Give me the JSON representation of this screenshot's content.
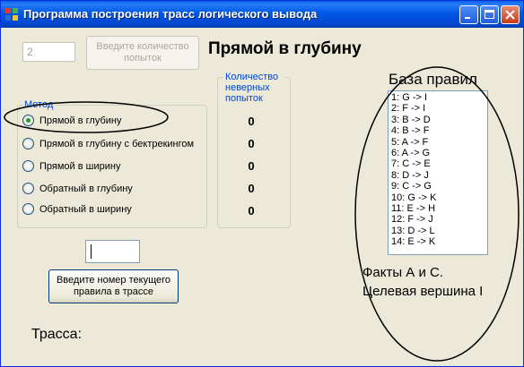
{
  "window": {
    "title": "Программа построения трасс логического вывода"
  },
  "attempts_input": {
    "value": "2"
  },
  "attempts_button": {
    "label": "Введите количество попыток"
  },
  "method_title": "Прямой в глубину",
  "method_group": {
    "caption": "Метод",
    "options": [
      {
        "label": "Прямой в глубину",
        "checked": true
      },
      {
        "label": "Прямой в глубину с бектрекингом",
        "checked": false
      },
      {
        "label": "Прямой в ширину",
        "checked": false
      },
      {
        "label": "Обратный в глубину",
        "checked": false
      },
      {
        "label": "Обратный в ширину",
        "checked": false
      }
    ]
  },
  "wrong_attempts": {
    "caption": "Количество неверных попыток",
    "values": [
      "0",
      "0",
      "0",
      "0",
      "0"
    ]
  },
  "rule_input": {
    "value": ""
  },
  "rule_button": {
    "label": "Введите номер текущего правила в трассе"
  },
  "trace_label": "Трасса:",
  "rules": {
    "title": "База правил",
    "items": [
      "1: G -> I",
      "2: F -> I",
      "3: B -> D",
      "4: B -> F",
      "5: A -> F",
      "6: A -> G",
      "7: C -> E",
      "8: D -> J",
      "9: C -> G",
      "10: G -> K",
      "11: E -> H",
      "12: F -> J",
      "13: D -> L",
      "14: E -> K"
    ]
  },
  "facts": {
    "line1": "Факты А и С.",
    "line2": "Целевая вершина I"
  },
  "colors": {
    "titlebar": "#0058e6",
    "caption": "#0046d5",
    "radio_dot": "#21a121",
    "face": "#ece9d8"
  }
}
